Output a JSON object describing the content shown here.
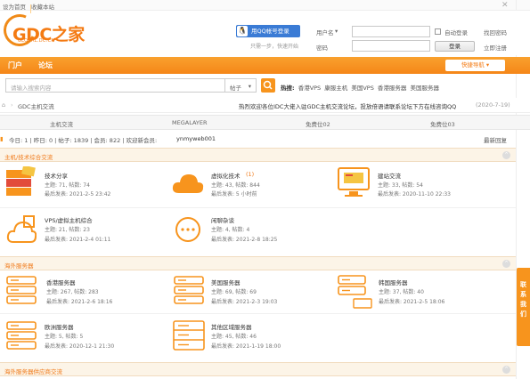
{
  "topbar": {
    "set_home": "设为首页",
    "bookmark": "收藏本站",
    "close": "✕"
  },
  "logo": {
    "text": "GDC之家",
    "sub": "GLOBAL.DC.CN"
  },
  "login": {
    "qq_button": "用QQ帐号登录",
    "qq_tip": "只需一步，快速开始",
    "username_label": "用户名",
    "password_label": "密码",
    "remember_label": "自动登录",
    "forgot_label": "找回密码",
    "login_button": "登录",
    "register_label": "立即注册"
  },
  "nav": {
    "items": [
      "门户",
      "论坛"
    ],
    "quick_nav": "快捷导航"
  },
  "search": {
    "placeholder": "请输入搜索内容",
    "scope": "帖子",
    "hot_label": "热搜:",
    "hot_terms": [
      "香港VPS",
      "康服主机",
      "美国VPS",
      "香港服务器",
      "美国服务器"
    ]
  },
  "breadcrumb": {
    "label": "GDC主机交流",
    "notice": "热烈欢迎各位IDC大佬入驻GDC主机交流论坛，投放倍语请联系论坛下方在线咨询QQ",
    "notice_date": "(2020-7-19)"
  },
  "tabs": [
    "主机交流",
    "MEGALAYER",
    "免费位02",
    "免费位03"
  ],
  "stats": {
    "text": "今日: 1 | 昨日: 0 | 帖子: 1839 | 会员: 822 | 欢迎新会员:",
    "newest_member": "ynmyweb001",
    "latest": "最新回复"
  },
  "sections": [
    {
      "title": "主机/技术综合交流",
      "forums": [
        {
          "name": "技术分享",
          "counts": "主题: 71, 帖数: 74",
          "last": "最后发表: 2021-2-5 23:42",
          "new_badge": ""
        },
        {
          "name": "虚拟化技术",
          "counts": "主题: 43, 帖数: 844",
          "last": "最后发表: 5 小时前",
          "new_badge": "(1)"
        },
        {
          "name": "建站交流",
          "counts": "主题: 33, 帖数: 54",
          "last": "最后发表: 2020-11-10 22:33",
          "new_badge": ""
        },
        {
          "name": "VPS/虚拟主机综合",
          "counts": "主题: 21, 帖数: 23",
          "last": "最后发表: 2021-2-4 01:11",
          "new_badge": ""
        },
        {
          "name": "闲聊杂谈",
          "counts": "主题: 4, 帖数: 4",
          "last": "最后发表: 2021-2-8 18:25",
          "new_badge": ""
        }
      ]
    },
    {
      "title": "海外服务器",
      "forums": [
        {
          "name": "香港服务器",
          "counts": "主题: 267, 帖数: 283",
          "last": "最后发表: 2021-2-6 18:16",
          "new_badge": ""
        },
        {
          "name": "美国服务器",
          "counts": "主题: 69, 帖数: 69",
          "last": "最后发表: 2021-2-3 19:03",
          "new_badge": ""
        },
        {
          "name": "韩国服务器",
          "counts": "主题: 37, 帖数: 40",
          "last": "最后发表: 2021-2-5 18:06",
          "new_badge": ""
        },
        {
          "name": "欧洲服务器",
          "counts": "主题: 5, 帖数: 5",
          "last": "最后发表: 2020-12-1 21:30",
          "new_badge": ""
        },
        {
          "name": "其他区域服务器",
          "counts": "主题: 45, 帖数: 46",
          "last": "最后发表: 2021-1-19 18:00",
          "new_badge": ""
        }
      ]
    },
    {
      "title": "海外服务器供应商交流",
      "forums": []
    }
  ],
  "sidetab": "联系我们",
  "colors": {
    "accent": "#f7941d",
    "nav_top": "#f9a12e",
    "nav_bottom": "#f58618",
    "qq_blue": "#3a7bd5"
  }
}
